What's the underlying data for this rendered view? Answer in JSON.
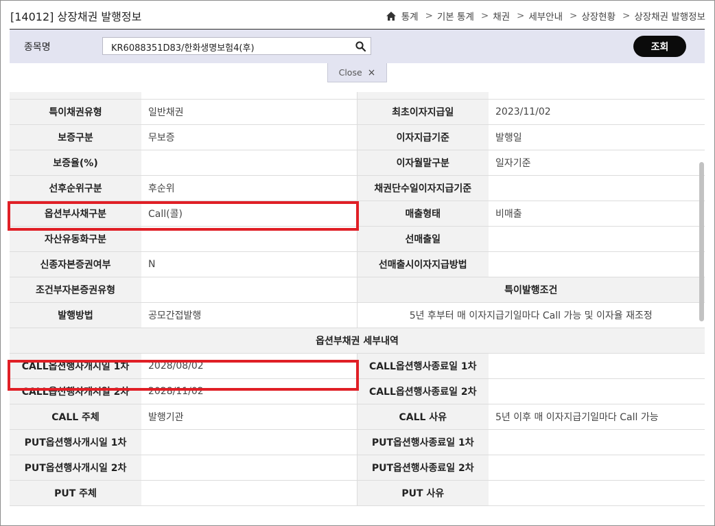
{
  "header": {
    "title": "[14012] 상장채권 발행정보",
    "breadcrumb": [
      "통계",
      "기본 통계",
      "채권",
      "세부안내",
      "상장현황",
      "상장채권 발행정보"
    ]
  },
  "search": {
    "label": "종목명",
    "value": "KR6088351D83/한화생명보험4(후)",
    "button": "조회",
    "close": "Close"
  },
  "rows": [
    {
      "l1": "특이채권유형",
      "v1": "일반채권",
      "l2": "최초이자지급일",
      "v2": "2023/11/02"
    },
    {
      "l1": "보증구분",
      "v1": "무보증",
      "l2": "이자지급기준",
      "v2": "발행일"
    },
    {
      "l1": "보증율(%)",
      "v1": "",
      "l2": "이자월말구분",
      "v2": "일자기준"
    },
    {
      "l1": "선후순위구분",
      "v1": "후순위",
      "l2": "채권단수일이자지급기준",
      "v2": ""
    },
    {
      "l1": "옵션부사채구분",
      "v1": "Call(콜)",
      "l2": "매출형태",
      "v2": "비매출"
    },
    {
      "l1": "자산유동화구분",
      "v1": "",
      "l2": "선매출일",
      "v2": ""
    },
    {
      "l1": "신종자본증권여부",
      "v1": "N",
      "l2": "선매출시이자지급방법",
      "v2": ""
    }
  ],
  "special": {
    "l1": "조건부자본증권유형",
    "v1": "",
    "heading": "특이발행조건",
    "l2": "발행방법",
    "v2": "공모간접발행",
    "condition": "5년 후부터 매 이자지급기일마다 Call 가능 및 이자율 재조정"
  },
  "option_section": {
    "heading": "옵션부채권 세부내역",
    "rows": [
      {
        "l1": "CALL옵션행사개시일 1차",
        "v1": "2028/08/02",
        "l2": "CALL옵션행사종료일 1차",
        "v2": ""
      },
      {
        "l1": "CALL옵션행사개시일 2차",
        "v1": "2028/11/02",
        "l2": "CALL옵션행사종료일 2차",
        "v2": ""
      },
      {
        "l1": "CALL 주체",
        "v1": "발행기관",
        "l2": "CALL 사유",
        "v2": "5년 이후 매 이자지급기일마다 Call 가능"
      },
      {
        "l1": "PUT옵션행사개시일 1차",
        "v1": "",
        "l2": "PUT옵션행사종료일 1차",
        "v2": ""
      },
      {
        "l1": "PUT옵션행사개시일 2차",
        "v1": "",
        "l2": "PUT옵션행사종료일 2차",
        "v2": ""
      },
      {
        "l1": "PUT 주체",
        "v1": "",
        "l2": "PUT 사유",
        "v2": ""
      }
    ]
  },
  "colors": {
    "highlight": "#e01f26",
    "searchbar": "#e3e4f1",
    "label_bg": "#f2f2f2"
  }
}
